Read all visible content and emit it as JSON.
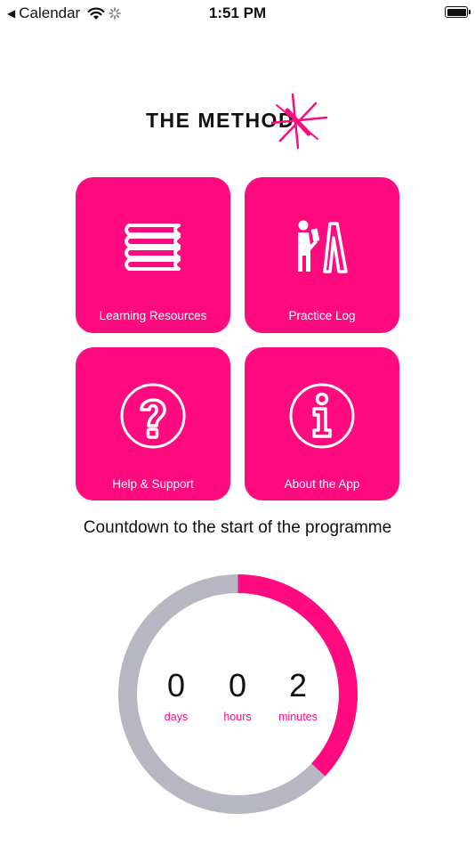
{
  "status_bar": {
    "back_app": "Calendar",
    "time": "1:51 PM"
  },
  "logo": {
    "text": "THE METHOD"
  },
  "tiles": [
    {
      "label": "Learning Resources",
      "icon": "books-icon"
    },
    {
      "label": "Practice Log",
      "icon": "person-easel-icon"
    },
    {
      "label": "Help & Support",
      "icon": "question-circle-icon"
    },
    {
      "label": "About the App",
      "icon": "info-circle-icon"
    }
  ],
  "countdown": {
    "title": "Countdown to the start of the programme",
    "progress_fraction": 0.37,
    "units": [
      {
        "value": "0",
        "label": "days"
      },
      {
        "value": "0",
        "label": "hours"
      },
      {
        "value": "2",
        "label": "minutes"
      }
    ]
  },
  "colors": {
    "accent": "#ff0a7f",
    "ring_track": "#b6b7c3",
    "text": "#111111",
    "background": "#ffffff"
  }
}
